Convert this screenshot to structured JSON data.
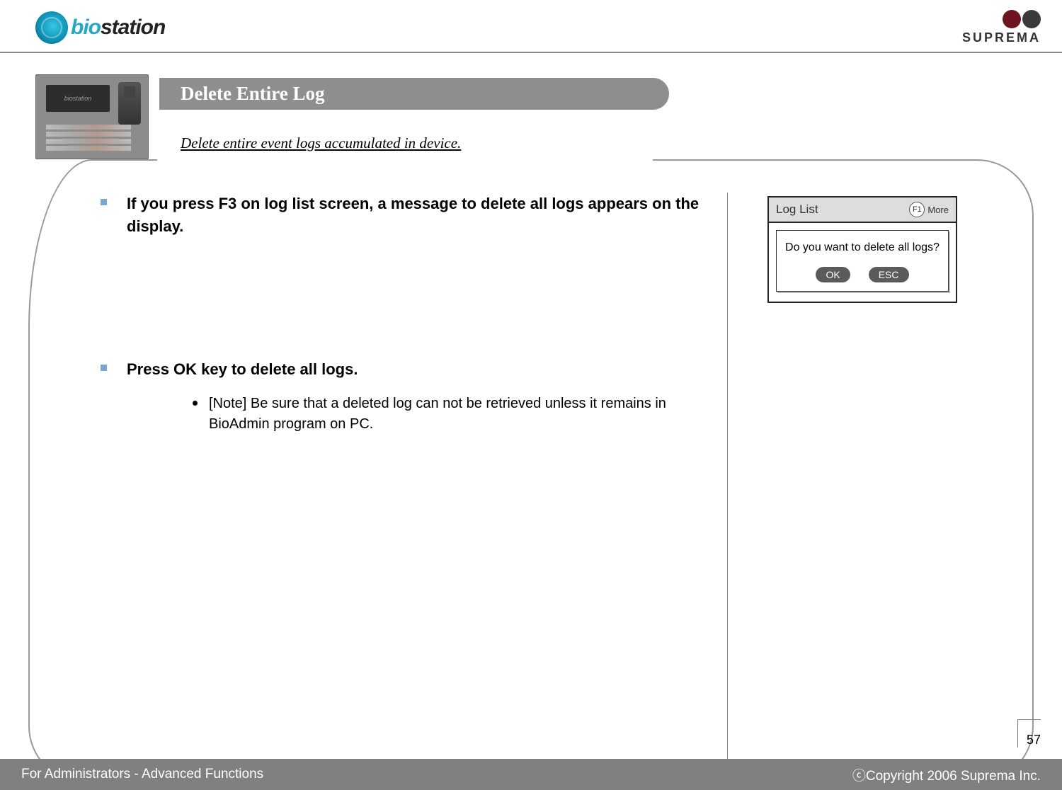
{
  "header": {
    "product_logo_text_bio": "bio",
    "product_logo_text_station": "station",
    "company_name": "SUPREMA"
  },
  "page": {
    "title": "Delete Entire Log",
    "subtitle": "Delete entire event logs accumulated in device.",
    "number": "57"
  },
  "instructions": [
    {
      "text": "If you press F3 on log list screen, a message to delete all logs appears on the display.",
      "subs": []
    },
    {
      "text": "Press OK key to delete all logs.",
      "subs": [
        "[Note] Be sure that a deleted log can not be retrieved unless it remains in BioAdmin program on PC."
      ]
    }
  ],
  "device": {
    "title": "Log List",
    "f1_label": "F1",
    "more_label": "More",
    "message": "Do you want to delete all logs?",
    "ok_label": "OK",
    "esc_label": "ESC"
  },
  "footer": {
    "left": "For Administrators - Advanced Functions",
    "right": "ⓒCopyright 2006 Suprema Inc."
  }
}
